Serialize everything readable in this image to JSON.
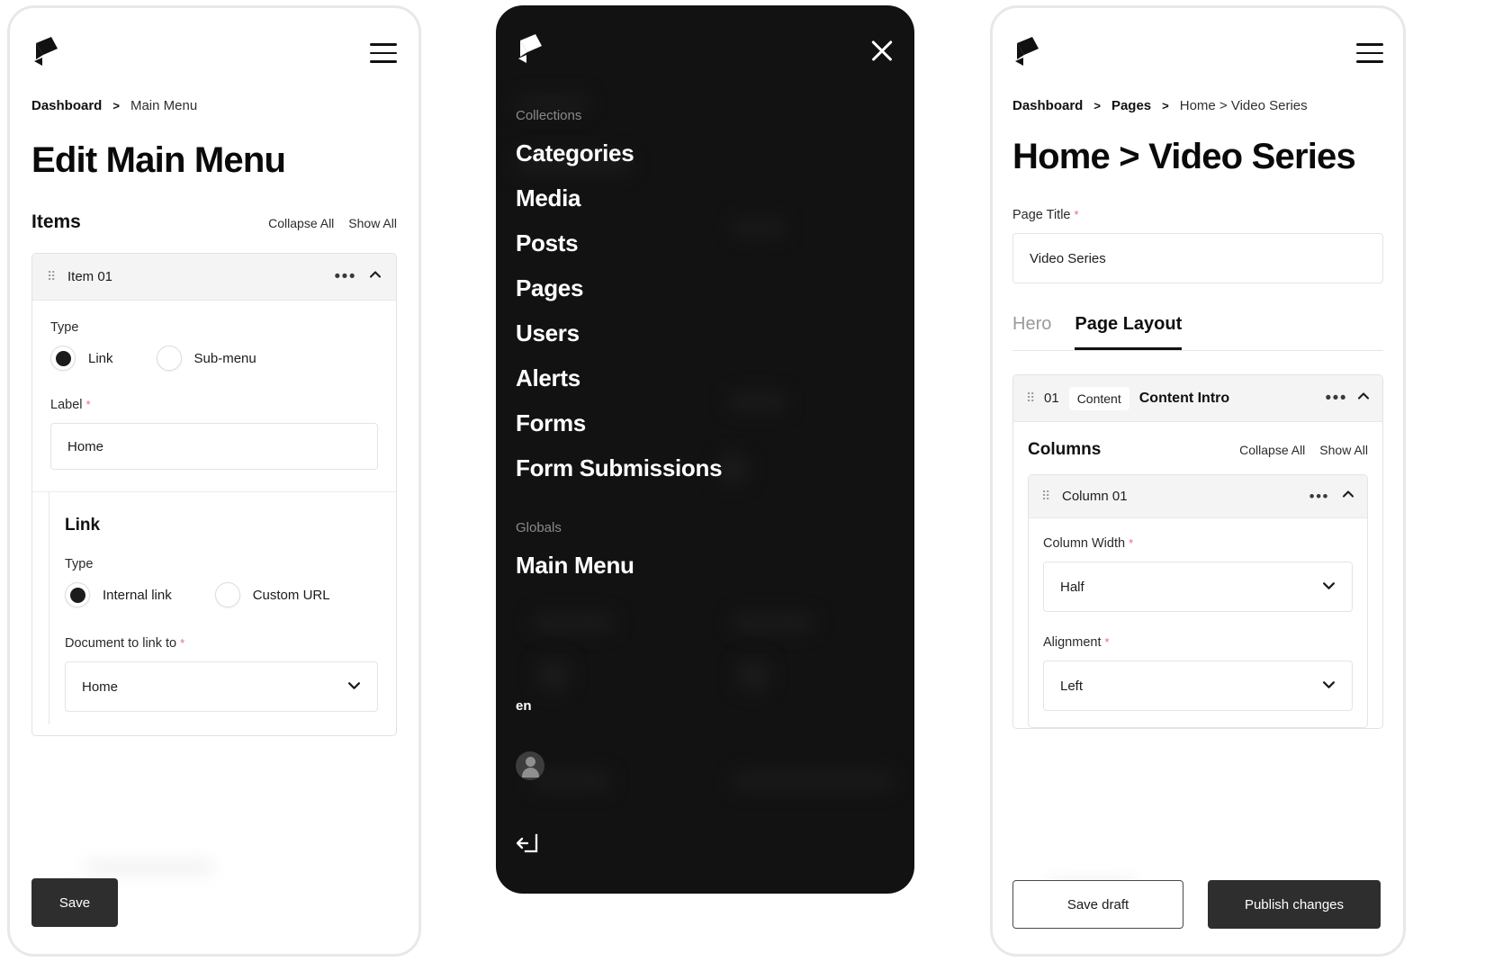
{
  "panel_one": {
    "logo": "payload-logo",
    "menu_icon": "hamburger-icon",
    "breadcrumb": {
      "root": "Dashboard",
      "separator": ">",
      "current": "Main Menu"
    },
    "page_title": "Edit Main Menu",
    "items_section": {
      "title": "Items",
      "collapse_all": "Collapse All",
      "show_all": "Show All"
    },
    "item": {
      "header_title": "Item 01",
      "type_label": "Type",
      "type_options": [
        {
          "label": "Link",
          "selected": true
        },
        {
          "label": "Sub-menu",
          "selected": false
        }
      ],
      "label_field": {
        "label": "Label",
        "required": "*",
        "value": "Home"
      },
      "link_group": {
        "heading": "Link",
        "type_label": "Type",
        "type_options": [
          {
            "label": "Internal link",
            "selected": true
          },
          {
            "label": "Custom URL",
            "selected": false
          }
        ],
        "document_field": {
          "label": "Document to link to",
          "required": "*",
          "value": "Home"
        }
      }
    },
    "save_button": "Save"
  },
  "panel_two": {
    "logo": "payload-logo",
    "close_icon": "close-icon",
    "groups": [
      {
        "label": "Collections",
        "items": [
          "Categories",
          "Media",
          "Posts",
          "Pages",
          "Users",
          "Alerts",
          "Forms",
          "Form Submissions"
        ]
      },
      {
        "label": "Globals",
        "items": [
          "Main Menu"
        ]
      }
    ],
    "locale": "en",
    "avatar_icon": "user-avatar-icon",
    "logout_icon": "logout-icon"
  },
  "panel_three": {
    "logo": "payload-logo",
    "menu_icon": "hamburger-icon",
    "breadcrumb": {
      "root": "Dashboard",
      "separator": ">",
      "middle": "Pages",
      "current": "Home > Video Series"
    },
    "page_title": "Home > Video Series",
    "page_title_field": {
      "label": "Page Title",
      "required": "*",
      "value": "Video Series"
    },
    "tabs": [
      {
        "label": "Hero",
        "active": false
      },
      {
        "label": "Page Layout",
        "active": true
      }
    ],
    "block": {
      "index": "01",
      "chip": "Content",
      "title": "Content Intro",
      "columns_section": {
        "title": "Columns",
        "collapse_all": "Collapse All",
        "show_all": "Show All"
      },
      "column": {
        "header_title": "Column 01",
        "width_field": {
          "label": "Column Width",
          "required": "*",
          "value": "Half"
        },
        "alignment_field": {
          "label": "Alignment",
          "required": "*",
          "value": "Left"
        }
      }
    },
    "actions": {
      "save_draft": "Save draft",
      "publish": "Publish changes"
    }
  },
  "colors": {
    "dark_panel": "#121212",
    "dark_button": "#2e2e2e",
    "required_star": "#e8697f",
    "header_fill": "#f4f4f4",
    "border": "#e4e4e4"
  }
}
